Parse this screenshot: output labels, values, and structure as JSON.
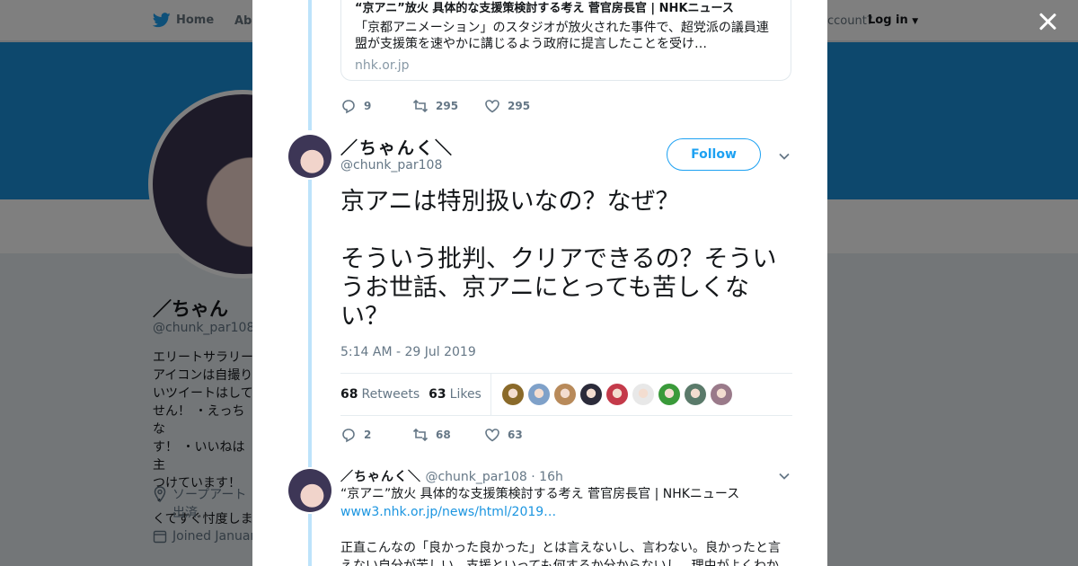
{
  "nav": {
    "home_label": "Home",
    "about_label": "Abo",
    "account_text": "account?",
    "login_label": "Log in"
  },
  "profile": {
    "name": "／ちゃん",
    "handle": "@chunk_par108",
    "bio": "エリートサラリー\nアイコンは自撮り\nいツイートはして\nせん！ ・えっちな\nす！ ・いいねは主\nつけています！ ・\nくてすぐ忖度しま",
    "location": "ソープアート\n出済",
    "joined": "Joined Januar"
  },
  "modal": {
    "prev_card": {
      "title": "“京アニ”放火 具体的な支援策検討する考え 菅官房長官 | NHKニュース",
      "description": "「京都アニメーション」のスタジオが放火された事件で、超党派の議員連盟が支援策を速やかに講じるよう政府に提言したことを受け…",
      "domain": "nhk.or.jp"
    },
    "prev_actions": {
      "replies": "9",
      "retweets": "295",
      "likes": "295"
    },
    "main_tweet": {
      "name": "／ちゃんく＼",
      "handle": "@chunk_par108",
      "follow_label": "Follow",
      "text_line1": "京アニは特別扱いなの？なぜ？",
      "text_line2": "そういう批判、クリアできるの？そういうお世話、京アニにとっても苦しくない？",
      "timestamp": "5:14 AM - 29 Jul 2019",
      "retweets_count": "68",
      "retweets_label": "Retweets",
      "likes_count": "63",
      "likes_label": "Likes",
      "actions": {
        "replies": "2",
        "retweets": "68",
        "likes": "63"
      }
    },
    "reply_tweet": {
      "name": "／ちゃんく＼",
      "handle": "@chunk_par108",
      "time": "· 16h",
      "line1": "“京アニ”放火 具体的な支援策検討する考え 菅官房長官 | NHKニュース",
      "link": "www3.nhk.or.jp/news/html/2019…",
      "line2": "正直こんなの「良かった良かった」とは言えないし、言わない。良かったと言えない自分が苦しい、支援といっても何するか分からないし、理由がよくわか"
    }
  },
  "colors": {
    "brand": "#1da1f2",
    "thread_line": "#bde3fb",
    "link": "#1b95e0",
    "muted": "#657786"
  },
  "liker_colors": [
    "#8a6a2a",
    "#7fa1c9",
    "#b88a5a",
    "#2b2b3a",
    "#c43a4a",
    "#e8e8e8",
    "#3a9a3a",
    "#5a7a6a",
    "#9a7a8a"
  ]
}
